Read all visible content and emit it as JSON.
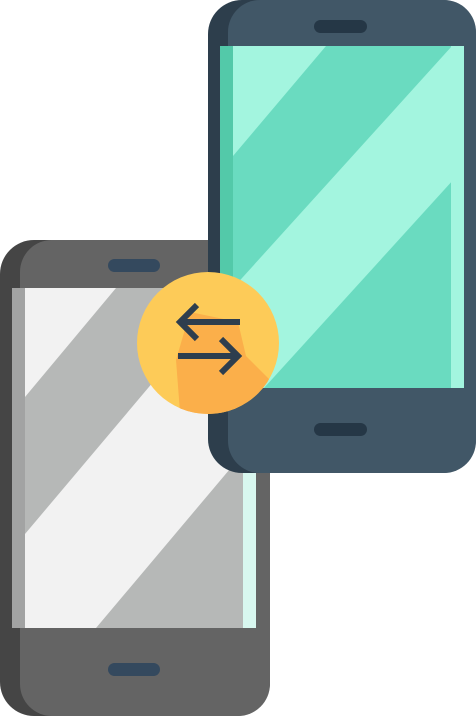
{
  "illustration": {
    "subject": "phone-to-phone-transfer-icon",
    "colors": {
      "gray_phone_body": "#646464",
      "gray_phone_side": "#454545",
      "gray_phone_screen": "#b6b8b7",
      "gray_phone_screen_glare": "#f2f2f2",
      "gray_phone_screen_edge": "#a2a3a3",
      "gray_phone_slot": "#34495e",
      "teal_phone_body": "#415767",
      "teal_phone_side": "#2d3e4c",
      "teal_phone_screen": "#6adbc0",
      "teal_phone_screen_glare": "#a3f5df",
      "teal_phone_screen_edge": "#53c9a9",
      "teal_phone_slot": "#253746",
      "badge_fill": "#fdcb58",
      "badge_shadow": "#fbaf4a",
      "arrow_color": "#2e3e4e"
    }
  }
}
